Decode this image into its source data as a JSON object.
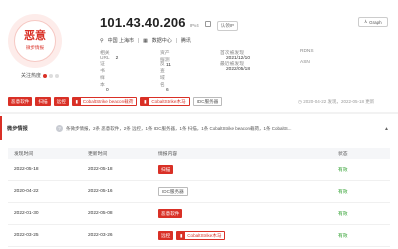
{
  "verdict": {
    "label": "恶意",
    "sub": "微步情报"
  },
  "attention_label": "关注热度",
  "header": {
    "ip": "101.43.40.206",
    "ip_version": "IPv4",
    "claim": "认领IP",
    "graph_button": "Graph"
  },
  "location": {
    "country_city": "中国 上海市",
    "org": "数据中心",
    "isp": "腾讯"
  },
  "stats": [
    [
      {
        "label": "相关URL",
        "value": "2"
      },
      {
        "label": "资产探测",
        "value": "11"
      },
      {
        "label": "首次被发现",
        "value": "2021/12/10"
      },
      {
        "label": "RDNS",
        "value": ""
      }
    ],
    [
      {
        "label": "证书样本",
        "value": "0"
      },
      {
        "label": "反查域名",
        "value": "6"
      },
      {
        "label": "最近被发现",
        "value": "2022/05/18"
      },
      {
        "label": "ASN",
        "value": ""
      }
    ]
  ],
  "tags": [
    {
      "text": "恶意软件",
      "style": "solid"
    },
    {
      "text": "扫描",
      "style": "solid"
    },
    {
      "text": "远控",
      "style": "solid"
    },
    {
      "text": "CobaltStrike beacon载荷",
      "style": "outline"
    },
    {
      "text": "CobaltStrike木马",
      "style": "outline"
    },
    {
      "text": "IDC服务器",
      "style": "gray"
    }
  ],
  "updated_text": "2020-04-22 发现，2022-05-18 更新",
  "intel": {
    "title": "微步情报",
    "summary": "条微步情报，2条 恶意软件，2条 远控，1条 IDC服务器，1条 扫描，1条 CobaltStrike beacon载荷，1条 CobaltS..."
  },
  "table": {
    "headers": [
      "发现时间",
      "更新时间",
      "情报内容",
      "状态"
    ],
    "rows": [
      {
        "found": "2022-05-18",
        "updated": "2022-05-18",
        "tags": [
          {
            "text": "扫描",
            "style": "solid"
          }
        ],
        "status": "有效"
      },
      {
        "found": "2020-04-22",
        "updated": "2022-05-16",
        "tags": [
          {
            "text": "IDC服务器",
            "style": "gray"
          }
        ],
        "status": "有效"
      },
      {
        "found": "2022-01-30",
        "updated": "2022-05-08",
        "tags": [
          {
            "text": "恶意软件",
            "style": "solid"
          }
        ],
        "status": "有效"
      },
      {
        "found": "2022-03-25",
        "updated": "2022-03-26",
        "tags": [
          {
            "text": "远控",
            "style": "solid"
          },
          {
            "text": "CobaltStrike木马",
            "style": "outline"
          }
        ],
        "status": "有效"
      }
    ]
  }
}
